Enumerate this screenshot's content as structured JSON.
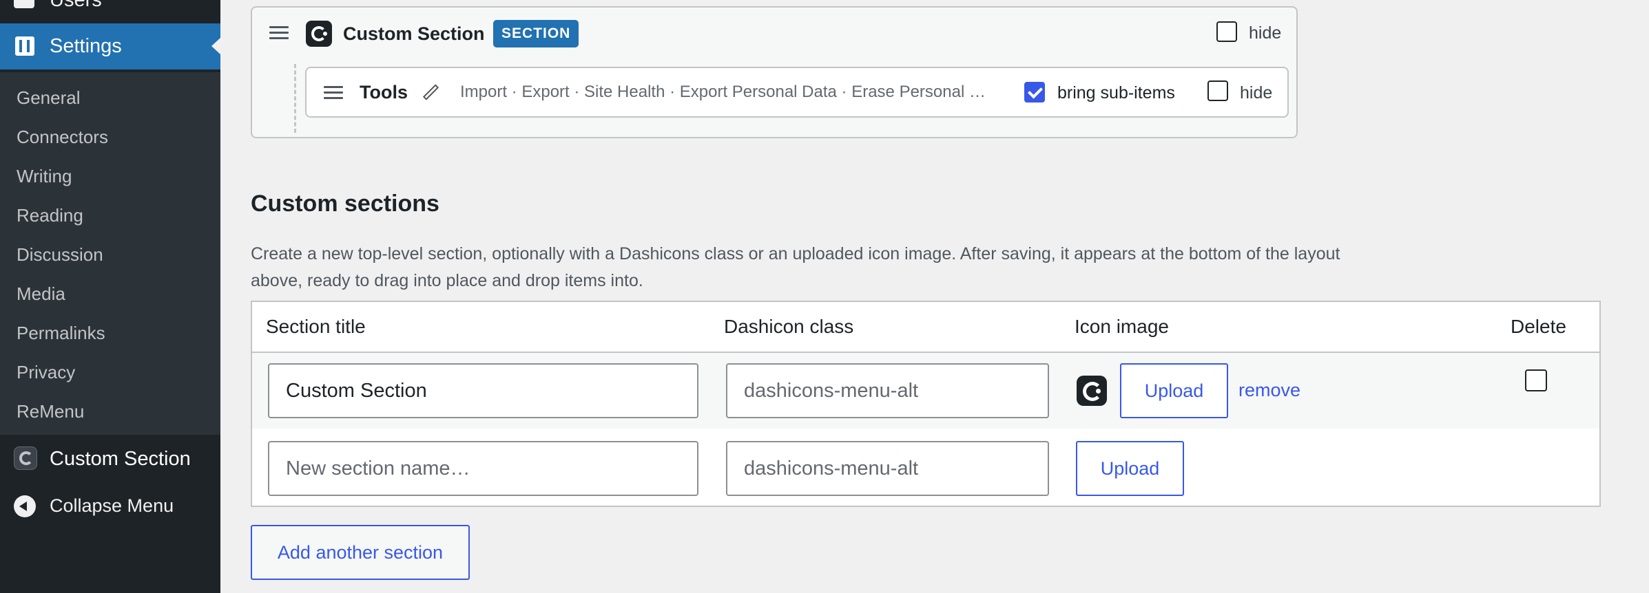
{
  "sidebar": {
    "top_item": {
      "label": "Users",
      "icon": "users-icon"
    },
    "current": {
      "label": "Settings",
      "icon": "settings-icon"
    },
    "submenu": [
      "General",
      "Connectors",
      "Writing",
      "Reading",
      "Discussion",
      "Media",
      "Permalinks",
      "Privacy",
      "ReMenu"
    ],
    "custom_section": {
      "label": "Custom Section",
      "icon": "custom-section-icon"
    },
    "collapse": {
      "label": "Collapse Menu",
      "icon": "collapse-arrow-icon"
    }
  },
  "layout": {
    "section": {
      "title": "Custom Section",
      "badge": "SECTION",
      "hide_label": "hide",
      "hide_checked": false
    },
    "item": {
      "title": "Tools",
      "subitems": "Import · Export · Site Health · Export Personal Data · Erase Personal …",
      "bring_label": "bring sub-items",
      "bring_checked": true,
      "hide_label": "hide",
      "hide_checked": false
    }
  },
  "custom_sections": {
    "heading": "Custom sections",
    "description": "Create a new top-level section, optionally with a Dashicons class or an uploaded icon image. After saving, it appears at the bottom of the layout above, ready to drag into place and drop items into.",
    "columns": [
      "Section title",
      "Dashicon class",
      "Icon image",
      "Delete"
    ],
    "rows": [
      {
        "title_value": "Custom Section",
        "dashicon_placeholder": "dashicons-menu-alt",
        "upload_label": "Upload",
        "remove_label": "remove",
        "delete_checked": false
      },
      {
        "title_placeholder": "New section name…",
        "dashicon_placeholder": "dashicons-menu-alt",
        "upload_label": "Upload"
      }
    ],
    "add_button": "Add another section"
  },
  "colors": {
    "sidebar_bg": "#1d2327",
    "sidebar_active": "#2271b1",
    "accent": "#3858e9",
    "badge": "#2271b1"
  }
}
